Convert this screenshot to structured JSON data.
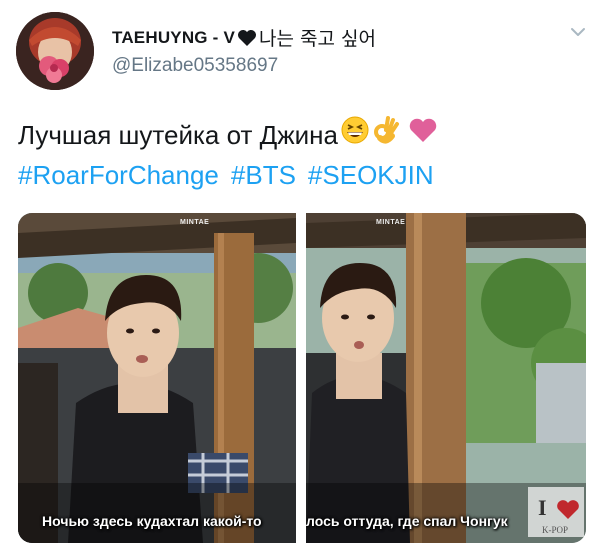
{
  "tweet": {
    "display_name": "TAEHUYNG - V",
    "name_suffix": "나는 죽고 싶어",
    "handle": "@Elizabe05358697",
    "text": "Лучшая шутейка от Джина",
    "hashtags": [
      "#RoarForChange",
      "#BTS",
      "#SEOKJIN"
    ],
    "emojis": [
      "grinning-squinting-face",
      "ok-hand",
      "heart"
    ],
    "icons": {
      "avatar": "avatar",
      "heart": "black-heart-icon",
      "menu": "chevron-down-icon"
    }
  },
  "media": [
    {
      "subtitle": "Ночью здесь кудахтал какой-то",
      "watermark": "MINTAE"
    },
    {
      "subtitle": "лось оттуда, где спал Чонгук",
      "watermark": "MINTAE",
      "badge_letters": "I",
      "badge_caption": "K-POP"
    }
  ],
  "colors": {
    "hashtag": "#1da1f2",
    "handle": "#657786",
    "text": "#14171a",
    "heart_emoji": "#e0245e"
  }
}
